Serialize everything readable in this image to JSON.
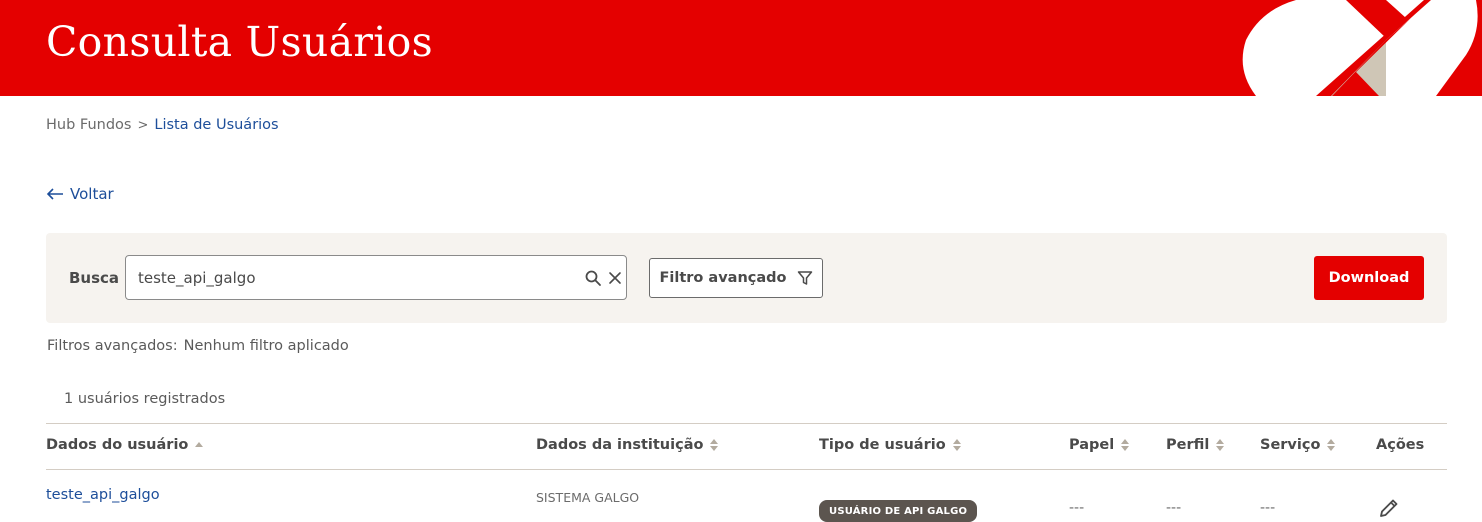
{
  "header": {
    "title": "Consulta Usuários"
  },
  "breadcrumb": {
    "root": "Hub Fundos",
    "separator": ">",
    "current": "Lista de Usuários"
  },
  "back": {
    "label": "Voltar",
    "icon": "arrow-left-icon"
  },
  "search": {
    "label": "Busca",
    "value": "teste_api_galgo",
    "search_icon": "search-icon",
    "clear_icon": "close-icon",
    "advanced_filter_label": "Filtro avançado",
    "filter_icon": "filter-icon",
    "download_label": "Download"
  },
  "filters": {
    "label": "Filtros avançados:",
    "value": "Nenhum filtro aplicado"
  },
  "table": {
    "count_label": "1 usuários registrados",
    "columns": [
      "Dados do usuário",
      "Dados da instituição",
      "Tipo de usuário",
      "Papel",
      "Perfil",
      "Serviço",
      "Ações"
    ],
    "rows": [
      {
        "user": "teste_api_galgo",
        "institution": "SISTEMA GALGO",
        "type": "USUÁRIO DE API GALGO",
        "role": "---",
        "profile": "---",
        "service": "---",
        "action_icon": "pencil-icon"
      }
    ]
  },
  "colors": {
    "brand": "#e40000",
    "link": "#1d4e9a",
    "panel": "#f6f3ef",
    "badge": "#5c554f"
  }
}
